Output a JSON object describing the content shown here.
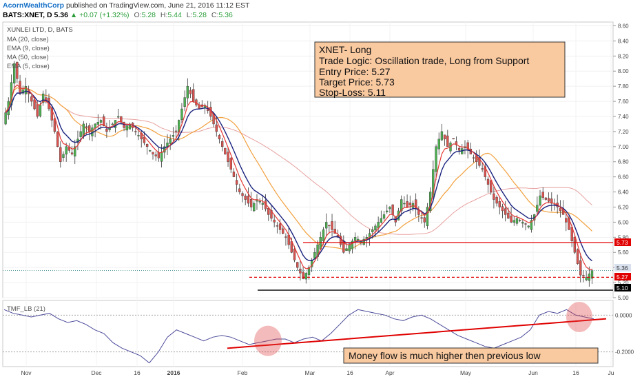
{
  "header": {
    "author": "AcornWealthCorp",
    "published_text": "published on TradingView.com, June 21, 2016 11:12 EST",
    "symbol": "BATS:XNET, D",
    "last": "5.36",
    "change": "▲ +0.07 (+1.32%)",
    "open_label": "O:",
    "open": "5.28",
    "high_label": "H:",
    "high": "5.44",
    "low_label": "L:",
    "low": "5.28",
    "close_label": "C:",
    "close": "5.36"
  },
  "legend": {
    "title": "XUNLEI LTD, D, BATS",
    "lines": [
      "MA (20, close)",
      "EMA (9, close)",
      "MA (50, close)",
      "EMA (5, close)"
    ]
  },
  "info_box": {
    "lines": [
      "XNET- Long",
      "Trade Logic: Oscillation trade, Long from Support",
      "Entry Price: 5.27",
      "Target Price: 5.73",
      "Stop-Loss: 5.11"
    ]
  },
  "money_flow_note": "Money flow is much higher then previous low",
  "price_tags": {
    "last": "5.36",
    "target": "5.73",
    "entry": "5.27",
    "stop": "5.10"
  },
  "colors": {
    "up": "#4caf50",
    "down": "#d9534f",
    "ma20": "#f2a03d",
    "ema9": "#1a237e",
    "ma50": "#e8a0a0",
    "ema5": "#e53935",
    "tmf": "#4a4a9a",
    "annotation_red": "#e00000",
    "box_fill": "#f9c9a0"
  },
  "chart_data": [
    {
      "type": "candlestick",
      "title": "XUNLEI LTD, D, BATS",
      "ylim": [
        5.0,
        8.65
      ],
      "y_ticks": [
        "8.60",
        "8.40",
        "8.20",
        "8.00",
        "7.80",
        "7.60",
        "7.40",
        "7.20",
        "7.00",
        "6.80",
        "6.60",
        "6.40",
        "6.20",
        "6.00",
        "5.80",
        "5.60",
        "5.40",
        "5.20",
        "5.00"
      ],
      "x_ticks": [
        "Nov",
        "Dec",
        "16",
        "2016",
        "Feb",
        "Mar",
        "16",
        "Apr",
        "May",
        "Jun",
        "16",
        "Ju"
      ],
      "close_path": [
        7.3,
        7.6,
        8.1,
        7.7,
        7.8,
        7.6,
        7.4,
        7.7,
        7.5,
        7.2,
        6.8,
        7.0,
        6.9,
        7.1,
        7.3,
        7.2,
        7.3,
        7.35,
        7.2,
        7.3,
        7.4,
        7.25,
        7.3,
        7.2,
        7.1,
        7.0,
        6.9,
        6.85,
        7.0,
        7.1,
        7.2,
        7.5,
        7.8,
        7.6,
        7.5,
        7.55,
        7.4,
        7.2,
        7.0,
        6.8,
        6.6,
        6.4,
        6.3,
        6.2,
        6.3,
        6.25,
        6.1,
        6.0,
        5.9,
        5.8,
        5.6,
        5.4,
        5.25,
        5.4,
        5.6,
        5.8,
        6.0,
        5.9,
        5.8,
        5.6,
        5.7,
        5.8,
        5.75,
        5.8,
        5.9,
        6.0,
        6.1,
        6.2,
        6.0,
        6.3,
        6.2,
        6.25,
        6.1,
        6.0,
        6.4,
        7.0,
        7.2,
        7.0,
        7.1,
        6.95,
        7.0,
        6.9,
        6.8,
        6.7,
        6.5,
        6.3,
        6.2,
        6.1,
        6.0,
        6.05,
        6.0,
        5.95,
        6.1,
        6.35,
        6.3,
        6.25,
        6.2,
        6.1,
        5.9,
        5.6,
        5.3,
        5.27,
        5.36
      ],
      "series": [
        {
          "name": "MA (20, close)"
        },
        {
          "name": "EMA (9, close)"
        },
        {
          "name": "MA (50, close)"
        },
        {
          "name": "EMA (5, close)"
        }
      ],
      "horizontal_lines": [
        {
          "value": 5.73,
          "label": "5.73",
          "style": "solid"
        },
        {
          "value": 5.27,
          "label": "5.27",
          "style": "dashed"
        },
        {
          "value": 5.1,
          "label": "5.10",
          "style": "solid"
        },
        {
          "value": 5.36,
          "label": "5.36",
          "style": "dotted"
        }
      ]
    },
    {
      "type": "line",
      "title": "TMF_LB (21)",
      "ylim": [
        -0.28,
        0.08
      ],
      "y_ticks": [
        "0.0000",
        "-0.2000"
      ],
      "series": [
        {
          "name": "TMF_LB (21)",
          "values": [
            0.03,
            0.01,
            0.0,
            -0.01,
            0.0,
            0.01,
            -0.02,
            -0.04,
            -0.03,
            -0.05,
            -0.08,
            -0.1,
            -0.15,
            -0.18,
            -0.2,
            -0.22,
            -0.26,
            -0.2,
            -0.12,
            -0.08,
            -0.1,
            -0.12,
            -0.14,
            -0.12,
            -0.11,
            -0.12,
            -0.14,
            -0.16,
            -0.15,
            -0.14,
            -0.13,
            -0.13,
            -0.15,
            -0.13,
            -0.12,
            -0.14,
            -0.1,
            -0.05,
            0.0,
            0.03,
            0.02,
            0.01,
            0.0,
            -0.02,
            -0.03,
            -0.01,
            0.0,
            -0.02,
            -0.05,
            -0.08,
            -0.11,
            -0.13,
            -0.15,
            -0.17,
            -0.18,
            -0.16,
            -0.14,
            -0.12,
            -0.08,
            0.0,
            0.02,
            0.01,
            0.03,
            0.0,
            -0.01,
            -0.02
          ]
        }
      ]
    }
  ]
}
